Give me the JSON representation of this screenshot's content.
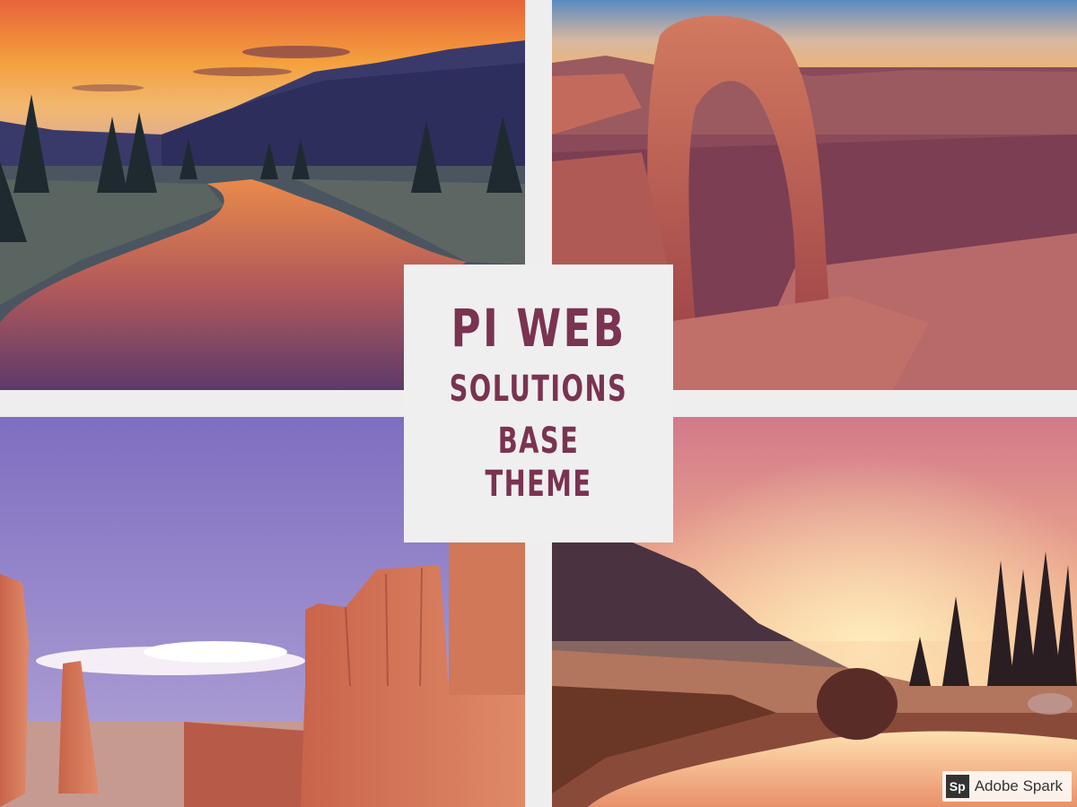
{
  "title": {
    "line1": "PI WEB",
    "line2": "SOLUTIONS",
    "line3": "BASE THEME"
  },
  "badge": {
    "logo": "Sp",
    "text": "Adobe Spark"
  },
  "colors": {
    "title_text": "#7a3351",
    "background": "#eeeeee"
  }
}
